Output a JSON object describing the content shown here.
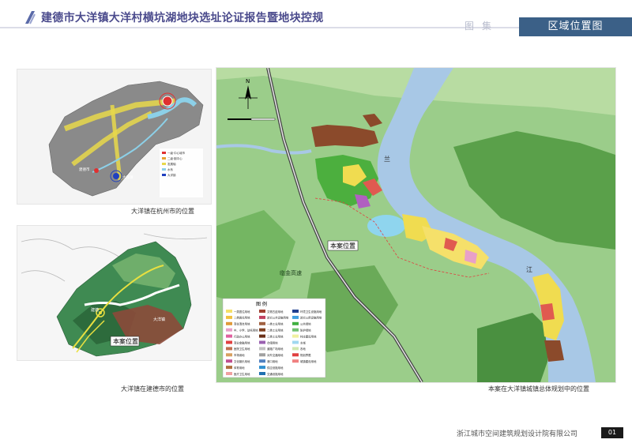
{
  "header": {
    "title": "建德市大洋镇大洋村横坑湖地块选址论证报告暨地块控规",
    "atlas_label": "图集",
    "section_tab": "区域位置图"
  },
  "maps": {
    "hangzhou": {
      "caption": "大洋镇在杭州市的位置",
      "label_city": "建德市",
      "label_town": "大洋镇"
    },
    "jiande": {
      "caption": "大洋镇在建德市的位置",
      "label_site": "本案位置",
      "label_town": "大洋镇",
      "label_city": "建德"
    },
    "plan": {
      "caption": "本案在大洋镇城镇总体规划中的位置",
      "site_label": "本案位置",
      "highway_label": "临金高速",
      "river_chars": [
        "兰",
        "江"
      ],
      "north": "N",
      "legend_title": "图 例",
      "legend_items": [
        {
          "label": "一类居住用地",
          "color": "#f5e06a"
        },
        {
          "label": "二类居住用地",
          "color": "#f0c040"
        },
        {
          "label": "商住混合用地",
          "color": "#e09a3a"
        },
        {
          "label": "中、小学、幼托用地",
          "color": "#e8a0c8"
        },
        {
          "label": "行政办公用地",
          "color": "#e060a0"
        },
        {
          "label": "商业金融用地",
          "color": "#e04040"
        },
        {
          "label": "医院卫生用地",
          "color": "#c07050"
        },
        {
          "label": "市场用地",
          "color": "#d8a060"
        },
        {
          "label": "文化娱乐用地",
          "color": "#c05090"
        },
        {
          "label": "体育用地",
          "color": "#b07040"
        },
        {
          "label": "医疗卫生用地",
          "color": "#f0a0a0"
        },
        {
          "label": "文物古迹用地",
          "color": "#a04030"
        },
        {
          "label": "其它公共设施用地",
          "color": "#c04060"
        },
        {
          "label": "一类工业用地",
          "color": "#a06040"
        },
        {
          "label": "二类工业用地",
          "color": "#804020"
        },
        {
          "label": "三类工业用地",
          "color": "#6a3018"
        },
        {
          "label": "仓储用地",
          "color": "#9a60b0"
        },
        {
          "label": "道路广场用地",
          "color": "#c0c0c0"
        },
        {
          "label": "对外交通用地",
          "color": "#a0a0a0"
        },
        {
          "label": "港口用地",
          "color": "#5080c0"
        },
        {
          "label": "供应设施用地",
          "color": "#3090d0"
        },
        {
          "label": "交通设施用地",
          "color": "#2070b0"
        },
        {
          "label": "环境卫生设施用地",
          "color": "#204090"
        },
        {
          "label": "其它公用设施用地",
          "color": "#40a0e0"
        },
        {
          "label": "公共绿地",
          "color": "#40b040"
        },
        {
          "label": "防护绿地",
          "color": "#70c070"
        },
        {
          "label": "村庄建设用地",
          "color": "#f0f0a0"
        },
        {
          "label": "水域",
          "color": "#a0d8f0"
        },
        {
          "label": "农地",
          "color": "#d0e8b0"
        },
        {
          "label": "规划界限",
          "color": "#e04040"
        },
        {
          "label": "城镇建设用地",
          "color": "#f08080"
        }
      ]
    }
  },
  "footer": {
    "company": "浙江城市空间建筑规划设计院有限公司",
    "page": "01"
  }
}
